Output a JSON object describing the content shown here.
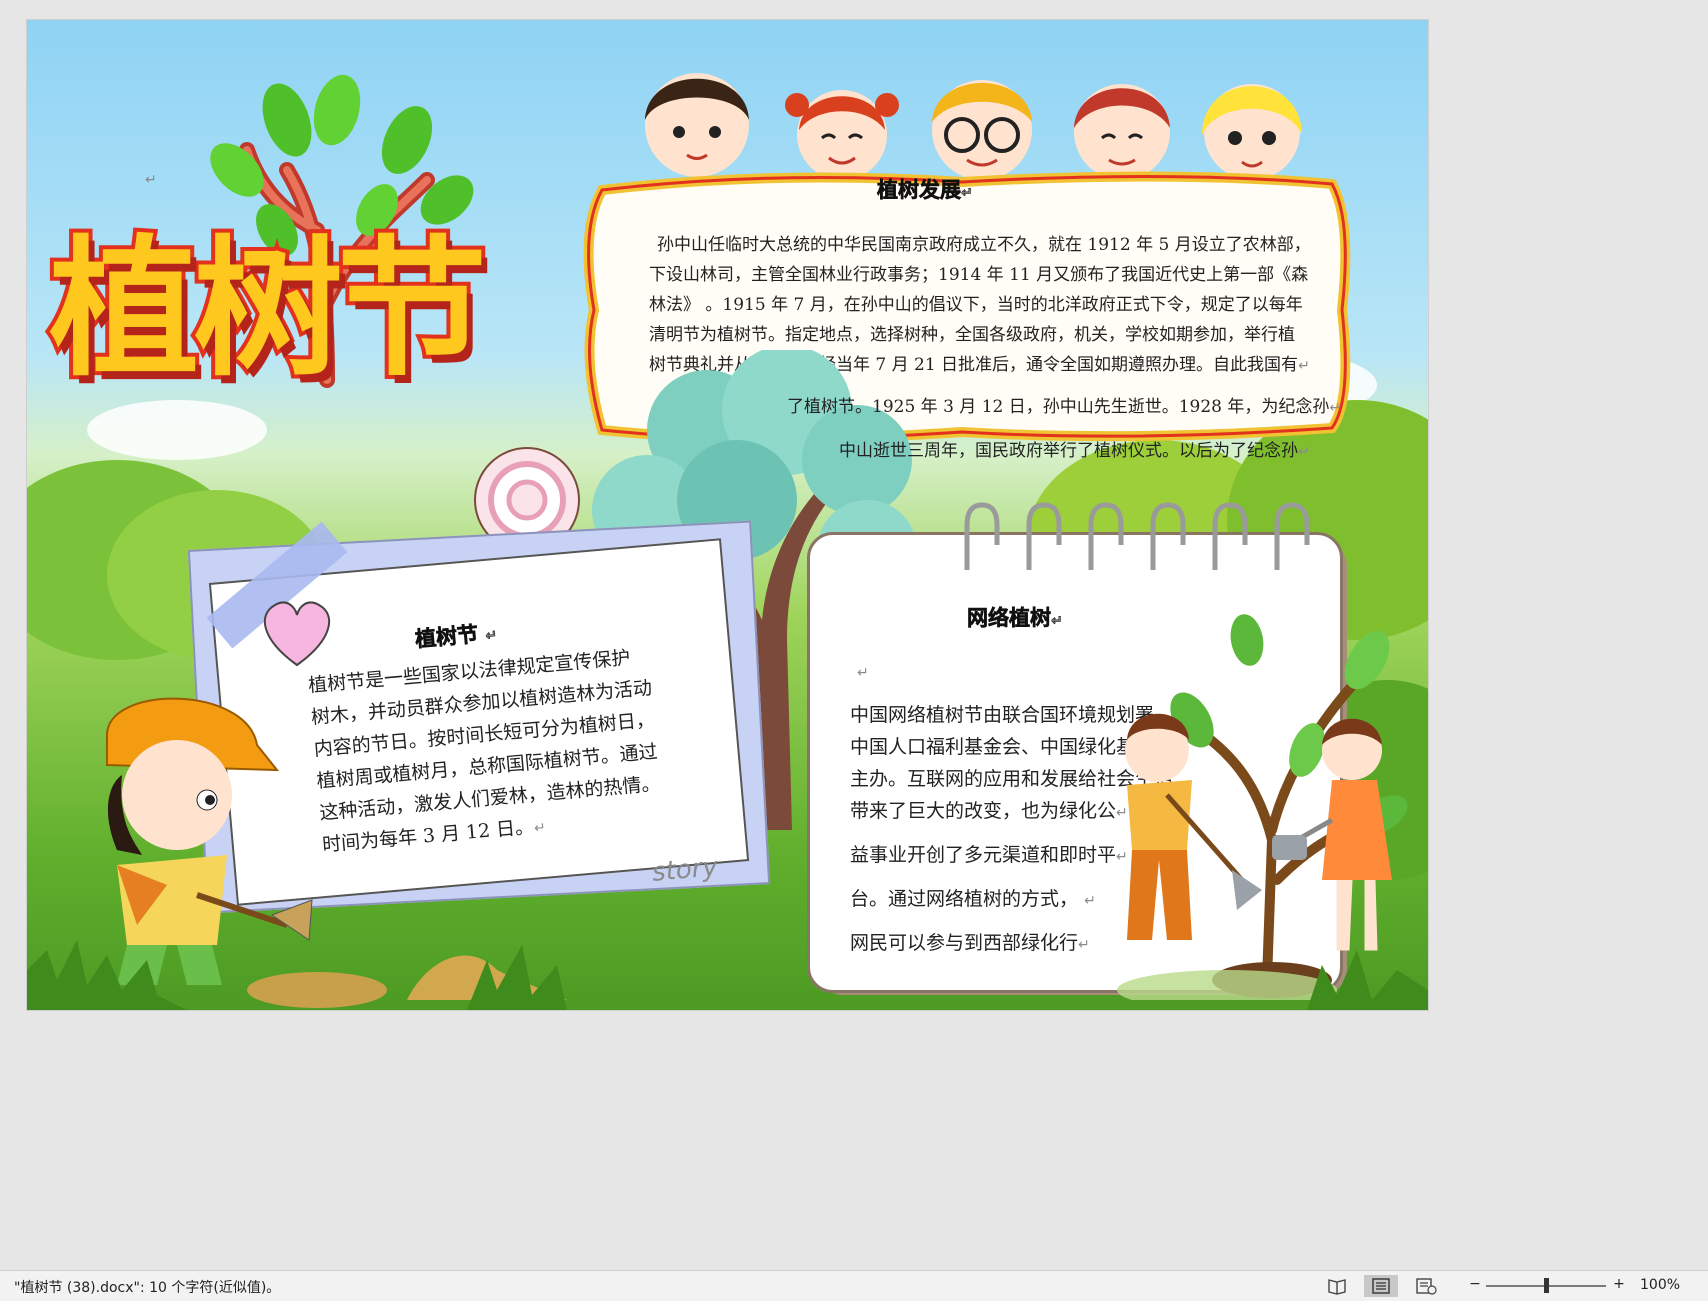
{
  "title_art": "植树节",
  "sections": {
    "development": {
      "heading": "植树发展",
      "lines": [
        "孙中山任临时大总统的中华民国南京政府成立不久，就在 1912 年 5 月设立了农林部，",
        "下设山林司，主管全国林业行政事务；1914 年 11 月又颁布了我国近代史上第一部《森",
        "林法》 。1915 年 7 月，在孙中山的倡议下，当时的北洋政府正式下令，规定了以每年",
        "清明节为植树节。指定地点，选择树种，全国各级政府，机关，学校如期参加，举行植",
        "树节典礼并从事植树。经当年 7 月 21 日批准后，通令全国如期遵照办理。自此我国有",
        "了植树节。1925 年 3 月 12 日，孙中山先生逝世。1928 年，为纪念孙",
        "中山逝世三周年，国民政府举行了植树仪式。以后为了纪念孙"
      ]
    },
    "arbor_day": {
      "heading": "植树节",
      "lines": [
        "植树节是一些国家以法律规定宣传保护",
        "树木，并动员群众参加以植树造林为活动",
        "内容的节日。按时间长短可分为植树日，",
        "植树周或植树月，总称国际植树节。通过",
        "这种活动，激发人们爱林，造林的热情。",
        "时间为每年 3 月 12 日。"
      ],
      "story_label": "story"
    },
    "online": {
      "heading": "网络植树",
      "lines": [
        "中国网络植树节由联合国环境规划署、",
        "中国人口福利基金会、中国绿化基金会",
        "主办。互联网的应用和发展给社会生活",
        "带来了巨大的改变，也为绿化公",
        "益事业开创了多元渠道和即时平",
        "台。通过网络植树的方式，",
        "网民可以参与到西部绿化行"
      ]
    }
  },
  "statusbar": {
    "doc_info": "\"植树节 (38).docx\": 10 个字符(近似值)。",
    "zoom_minus": "−",
    "zoom_plus": "+",
    "zoom": "100%",
    "zoom_fraction": 0.5
  },
  "colors": {
    "sky": "#8fd3f4",
    "grass": "#5fae2c",
    "title_yellow": "#ffc81e",
    "title_border": "#e2321d"
  }
}
